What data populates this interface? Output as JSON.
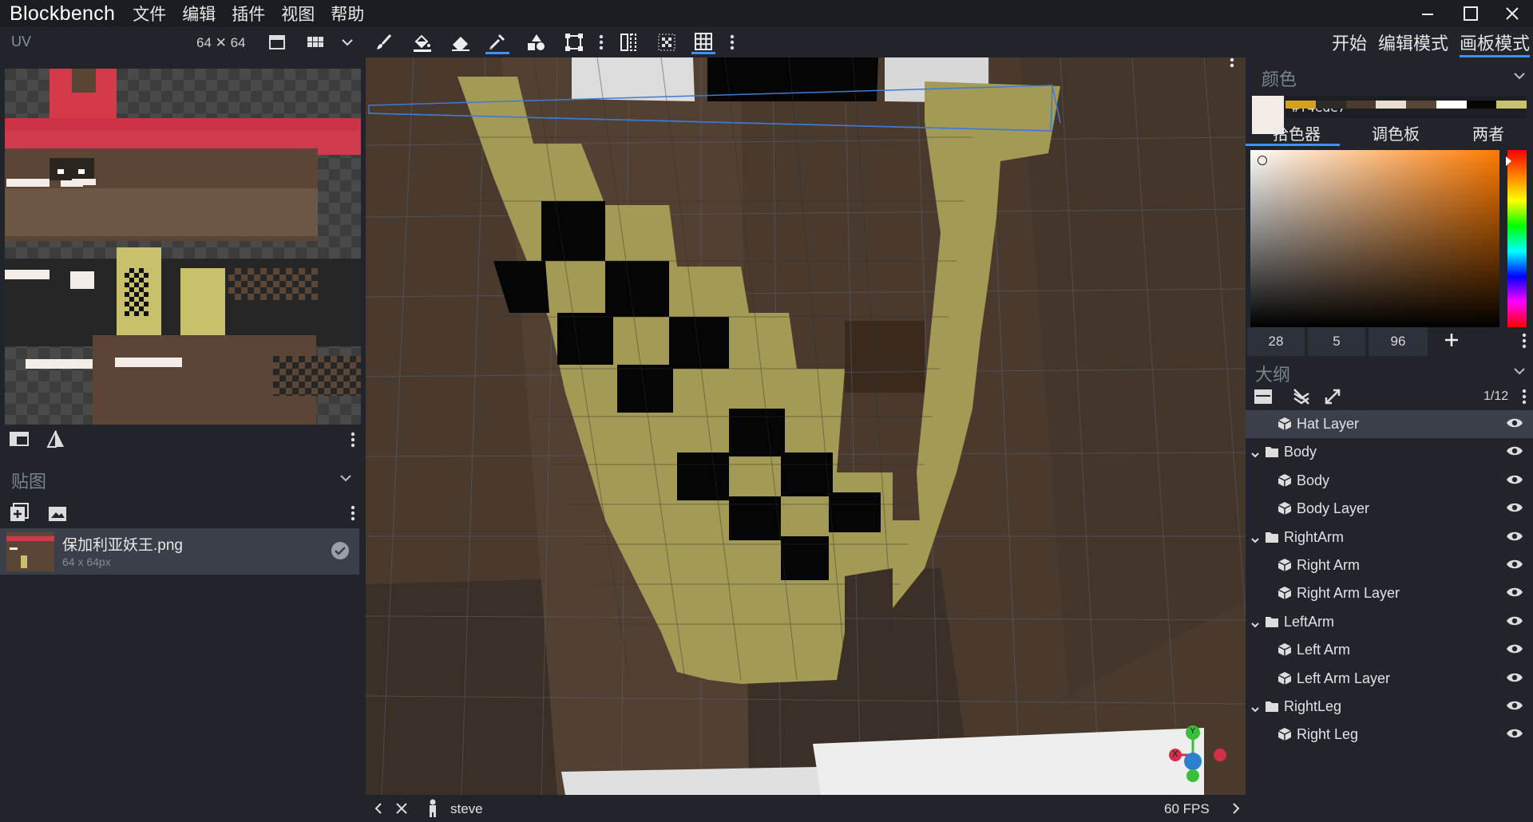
{
  "app": {
    "name": "Blockbench"
  },
  "menu": [
    "文件",
    "编辑",
    "插件",
    "视图",
    "帮助"
  ],
  "modes": {
    "start": "开始",
    "edit": "编辑模式",
    "paint": "画板模式",
    "active": "paint"
  },
  "uv_panel": {
    "title": "UV",
    "size": "64 ✕ 64"
  },
  "textures_panel": {
    "title": "贴图",
    "items": [
      {
        "name": "保加利亚妖王.png",
        "size": "64 x 64px"
      }
    ]
  },
  "color_panel": {
    "title": "颜色",
    "hex": "#f4ede7",
    "palette": [
      "#d4a017",
      "#2e2a25",
      "#4a3b2c",
      "#e8ddd1",
      "#5a4636",
      "#ffffff",
      "#050505",
      "#c8c06a"
    ],
    "tabs": [
      "拾色器",
      "调色板",
      "两者"
    ],
    "active_tab": 0,
    "hsv": [
      "28",
      "5",
      "96"
    ],
    "accent": "#3e90ff"
  },
  "outliner": {
    "title": "大纲",
    "count": "1/12",
    "items": [
      {
        "label": "Hat Layer",
        "type": "cube",
        "depth": 1,
        "selected": true
      },
      {
        "label": "Body",
        "type": "group",
        "depth": 0
      },
      {
        "label": "Body",
        "type": "cube",
        "depth": 1
      },
      {
        "label": "Body Layer",
        "type": "cube",
        "depth": 1
      },
      {
        "label": "RightArm",
        "type": "group",
        "depth": 0
      },
      {
        "label": "Right Arm",
        "type": "cube",
        "depth": 1
      },
      {
        "label": "Right Arm Layer",
        "type": "cube",
        "depth": 1
      },
      {
        "label": "LeftArm",
        "type": "group",
        "depth": 0
      },
      {
        "label": "Left Arm",
        "type": "cube",
        "depth": 1
      },
      {
        "label": "Left Arm Layer",
        "type": "cube",
        "depth": 1
      },
      {
        "label": "RightLeg",
        "type": "group",
        "depth": 0
      },
      {
        "label": "Right Leg",
        "type": "cube",
        "depth": 1
      }
    ]
  },
  "status": {
    "model": "steve",
    "fps": "60 FPS"
  },
  "gizmo": {
    "x": "X",
    "y": "Y"
  }
}
